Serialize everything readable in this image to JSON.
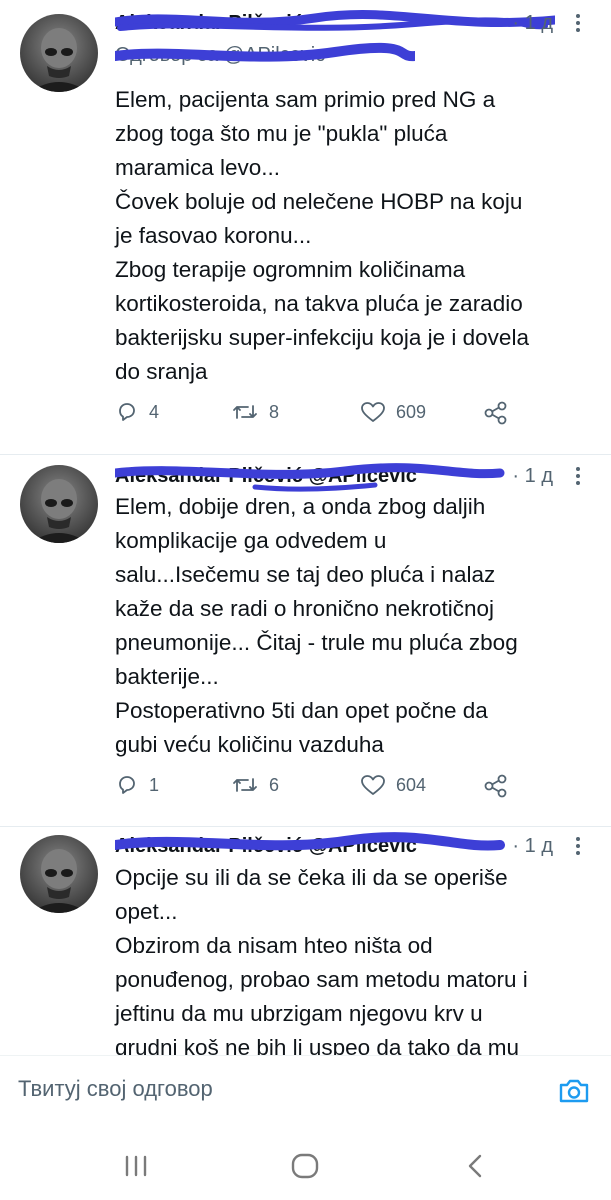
{
  "tweets": [
    {
      "author_name": "Aleksandar Pilčević",
      "time": "· 1 д",
      "replying_to": "Одговор за @APilcevic",
      "text_lines": [
        "Elem, pacijenta sam primio pred NG a",
        "zbog toga što mu je \"pukla\" pluća",
        "maramica levo...",
        "Čovek boluje od nelečene HOBP na koju",
        "je fasovao koronu...",
        "Zbog terapije ogromnim količinama",
        "kortikosteroida, na takva pluća je zaradio",
        "bakterijsku super-infekciju koja je i dovela",
        "do sranja"
      ],
      "replies": "4",
      "retweets": "8",
      "likes": "609"
    },
    {
      "author_name": "Aleksandar Pilčević @APilcevic",
      "time": "· 1 д",
      "text_lines": [
        "Elem, dobije dren, a onda zbog daljih",
        "komplikacije ga odvedem u",
        "salu...Isečemu se taj deo pluća i nalaz",
        "kaže da se radi o hronično nekrotičnoj",
        "pneumonije... Čitaj - trule mu pluća zbog",
        "bakterije...",
        "Postoperativno 5ti dan opet počne da",
        "gubi veću količinu vazduha"
      ],
      "replies": "1",
      "retweets": "6",
      "likes": "604"
    },
    {
      "author_name": "Aleksandar Pilčević @APilcevic",
      "time": "· 1 д",
      "text_lines": [
        "Opcije su ili da se čeka ili da se operiše",
        "opet...",
        "Obzirom da nisam hteo ništa od",
        "ponuđenog, probao sam metodu matoru i",
        "jeftinu da mu ubrzigam njegovu krv u",
        "grudni koš ne bih li uspeo da tako da mu"
      ]
    }
  ],
  "reply_bar": {
    "placeholder": "Твитуј свој одговор",
    "camera_icon": "camera-icon"
  },
  "navbar": {
    "recents_icon": "recents-icon",
    "home_icon": "home-icon",
    "back_icon": "back-icon"
  },
  "colors": {
    "text": "#0f1419",
    "secondary": "#536471",
    "accent": "#1d9bf0",
    "redaction": "#3d3fd6"
  }
}
